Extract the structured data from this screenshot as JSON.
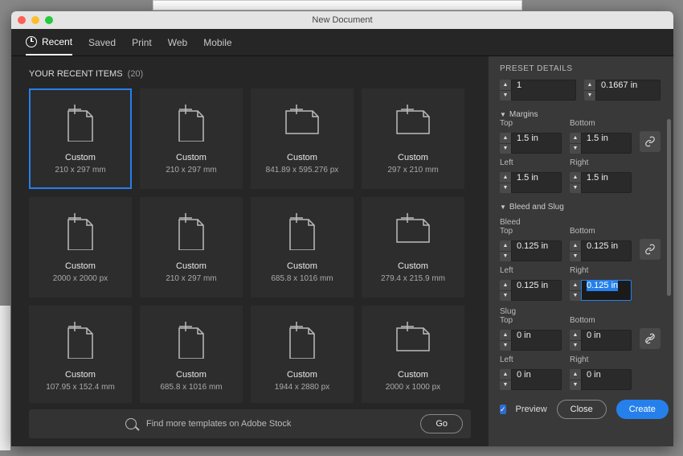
{
  "window": {
    "title": "New Document"
  },
  "tabs": {
    "recent": "Recent",
    "saved": "Saved",
    "print": "Print",
    "web": "Web",
    "mobile": "Mobile"
  },
  "recent_header": {
    "label": "YOUR RECENT ITEMS",
    "count": "(20)"
  },
  "presets": [
    {
      "label": "Custom",
      "dim": "210 x 297 mm",
      "orient": "portrait"
    },
    {
      "label": "Custom",
      "dim": "210 x 297 mm",
      "orient": "portrait"
    },
    {
      "label": "Custom",
      "dim": "841.89 x 595.276 px",
      "orient": "landscape"
    },
    {
      "label": "Custom",
      "dim": "297 x 210 mm",
      "orient": "landscape"
    },
    {
      "label": "Custom",
      "dim": "2000 x 2000 px",
      "orient": "portrait"
    },
    {
      "label": "Custom",
      "dim": "210 x 297 mm",
      "orient": "portrait"
    },
    {
      "label": "Custom",
      "dim": "685.8 x 1016 mm",
      "orient": "portrait"
    },
    {
      "label": "Custom",
      "dim": "279.4 x 215.9 mm",
      "orient": "landscape"
    },
    {
      "label": "Custom",
      "dim": "107.95 x 152.4 mm",
      "orient": "portrait"
    },
    {
      "label": "Custom",
      "dim": "685.8 x 1016 mm",
      "orient": "portrait"
    },
    {
      "label": "Custom",
      "dim": "1944 x 2880 px",
      "orient": "portrait"
    },
    {
      "label": "Custom",
      "dim": "2000 x 1000 px",
      "orient": "landscape"
    }
  ],
  "search": {
    "placeholder": "Find more templates on Adobe Stock",
    "go": "Go"
  },
  "details": {
    "header": "PRESET DETAILS",
    "pages": "1",
    "gutter": "0.1667 in",
    "margins_label": "Margins",
    "margins": {
      "top_lbl": "Top",
      "bottom_lbl": "Bottom",
      "left_lbl": "Left",
      "right_lbl": "Right",
      "top": "1.5 in",
      "bottom": "1.5 in",
      "left": "1.5 in",
      "right": "1.5 in"
    },
    "bleedslug_label": "Bleed and Slug",
    "bleed_label": "Bleed",
    "bleed": {
      "top_lbl": "Top",
      "bottom_lbl": "Bottom",
      "left_lbl": "Left",
      "right_lbl": "Right",
      "top": "0.125 in",
      "bottom": "0.125 in",
      "left": "0.125 in",
      "right": "0.125 in"
    },
    "slug_label": "Slug",
    "slug": {
      "top_lbl": "Top",
      "bottom_lbl": "Bottom",
      "left_lbl": "Left",
      "right_lbl": "Right",
      "top": "0 in",
      "bottom": "0 in",
      "left": "0 in",
      "right": "0 in"
    },
    "preview": "Preview",
    "close": "Close",
    "create": "Create"
  }
}
